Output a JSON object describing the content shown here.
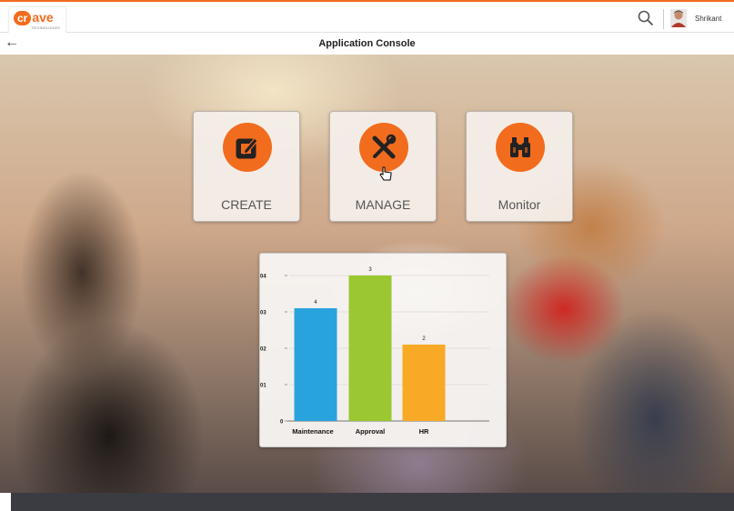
{
  "app": {
    "logo_main": "cr",
    "logo_rest": "ave",
    "logo_sub": "TECHNOLOGIES",
    "user_name": "Shrikant",
    "page_title": "Application Console",
    "back_label": "←"
  },
  "tiles": [
    {
      "label": "CREATE",
      "icon": "edit-icon"
    },
    {
      "label": "MANAGE",
      "icon": "tools-icon"
    },
    {
      "label": "Monitor",
      "icon": "binoculars-icon"
    }
  ],
  "colors": {
    "accent": "#f26c1e",
    "maintenance": "#29a3dc",
    "approval": "#9bc731",
    "hr": "#f8aa27"
  },
  "chart_data": {
    "type": "bar",
    "categories": [
      "Maintenance",
      "Approval",
      "HR"
    ],
    "values": [
      3.1,
      4.0,
      2.1
    ],
    "data_labels": [
      "4",
      "3",
      "2"
    ],
    "yticks": [
      "0",
      "01",
      "02",
      "03",
      "04"
    ],
    "ylim": [
      0,
      4
    ],
    "grid": true,
    "colors": [
      "#29a3dc",
      "#9bc731",
      "#f8aa27"
    ]
  }
}
